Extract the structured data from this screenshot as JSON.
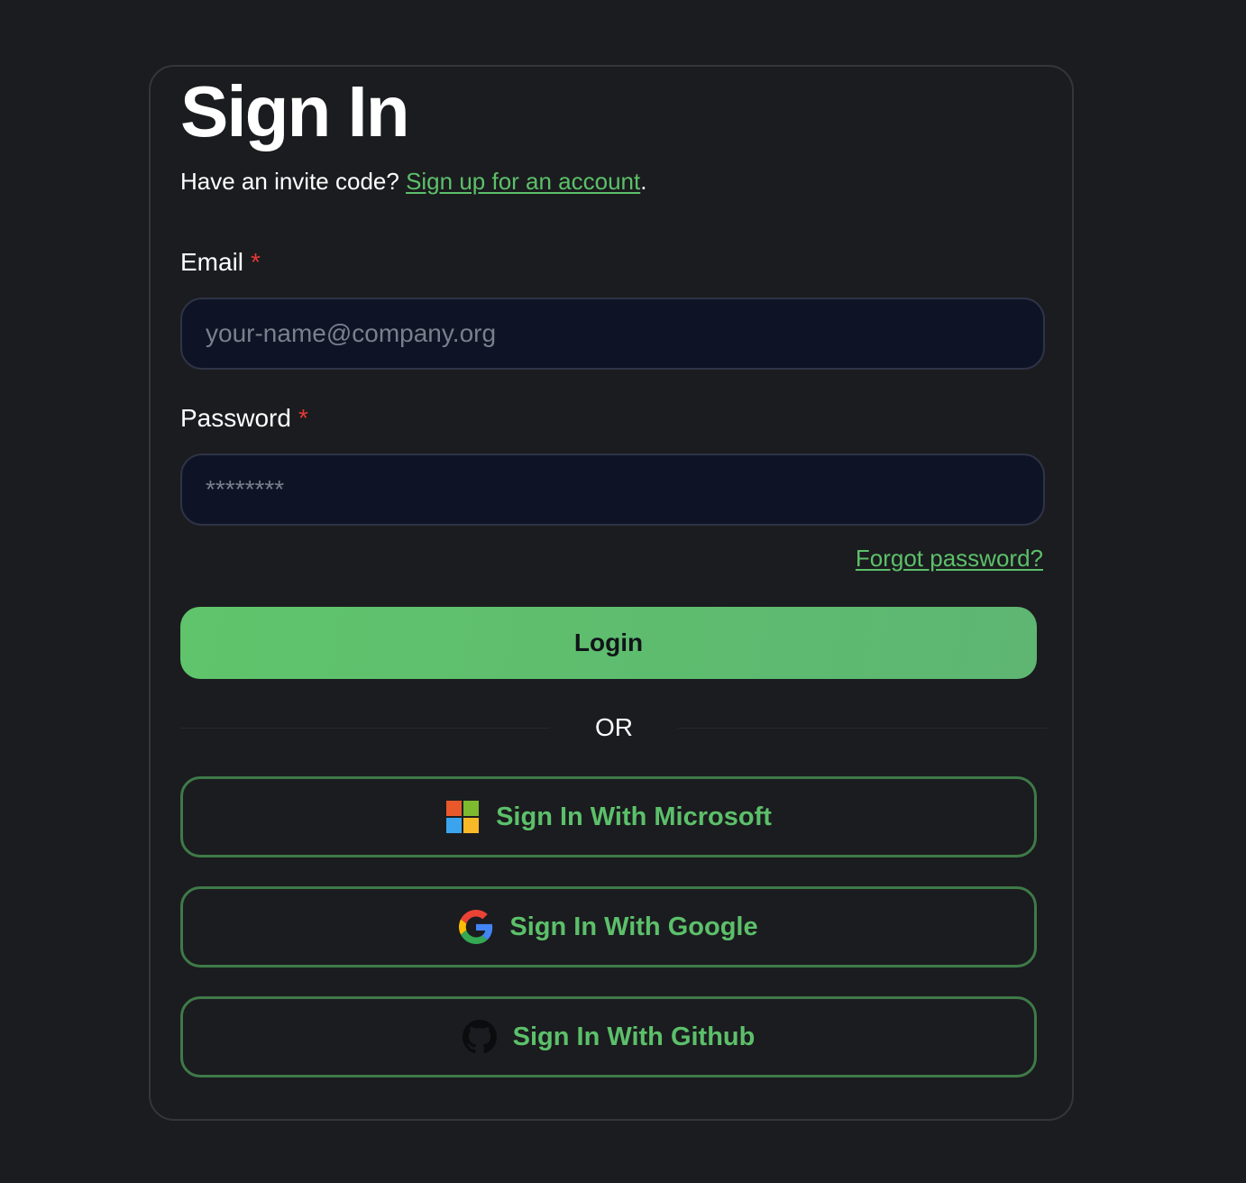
{
  "header": {
    "title": "Sign In",
    "subtitle_prefix": "Have an invite code?",
    "signup_link": "Sign up for an account",
    "subtitle_suffix": "."
  },
  "form": {
    "email_label": "Email",
    "email_placeholder": "your-name@company.org",
    "password_label": "Password",
    "password_placeholder": "********",
    "required_marker": "*",
    "forgot_link": "Forgot password?",
    "login_label": "Login"
  },
  "divider": {
    "text": "OR"
  },
  "oauth": {
    "microsoft_label": "Sign In With Microsoft",
    "google_label": "Sign In With Google",
    "github_label": "Sign In With Github"
  },
  "icons": {
    "microsoft": "microsoft-logo-icon",
    "google": "google-logo-icon",
    "github": "github-logo-icon"
  },
  "colors": {
    "background": "#1b1c1f",
    "accent": "#5cc06a",
    "required": "#e53935",
    "input_bg": "#0e1425"
  }
}
